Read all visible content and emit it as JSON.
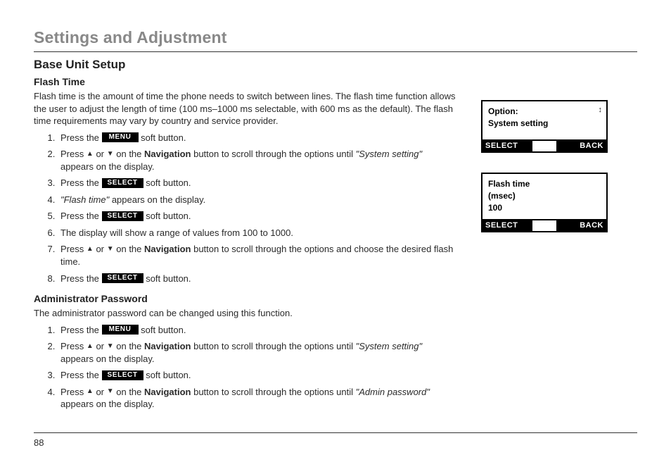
{
  "section_title": "Settings and Adjustment",
  "subhead": "Base Unit Setup",
  "flash_time": {
    "heading": "Flash Time",
    "intro": "Flash time is the amount of time the phone needs to switch between lines. The flash time function allows the user to adjust the length of time (100 ms–1000 ms selectable, with 600 ms as the default). The flash time requirements may vary by country and service provider.",
    "steps": {
      "s1a": "Press the ",
      "s1b": " soft button.",
      "s2a": "Press ",
      "s2b": " or ",
      "s2c": " on the ",
      "s2nav": "Navigation",
      "s2d": " button to scroll through the options until ",
      "s2e": "\"System setting\"",
      "s2f": " appears on the display.",
      "s3a": "Press the ",
      "s3b": " soft button.",
      "s4a": "\"Flash time\"",
      "s4b": " appears on the display.",
      "s5a": "Press the ",
      "s5b": " soft button.",
      "s6": "The display will show a range of values from 100 to 1000.",
      "s7a": "Press ",
      "s7b": " or ",
      "s7c": " on the ",
      "s7nav": "Navigation",
      "s7d": " button to scroll through the options and choose the desired flash time.",
      "s8a": "Press the ",
      "s8b": " soft button."
    }
  },
  "admin_pw": {
    "heading": "Administrator Password",
    "intro": "The administrator password can be changed using this function.",
    "steps": {
      "s1a": "Press the ",
      "s1b": " soft button.",
      "s2a": "Press ",
      "s2b": " or ",
      "s2c": " on the ",
      "s2nav": "Navigation",
      "s2d": " button to scroll through the options until ",
      "s2e": "\"System setting\"",
      "s2f": " appears on the display.",
      "s3a": "Press the ",
      "s3b": " soft button.",
      "s4a": "Press ",
      "s4b": " or ",
      "s4c": " on the ",
      "s4nav": "Navigation",
      "s4d": " button to scroll through the options until ",
      "s4e": "\"Admin password\"",
      "s4f": " appears on the display."
    }
  },
  "softkeys": {
    "menu": "MENU",
    "select": "SELECT"
  },
  "lcd1": {
    "line1": "Option:",
    "line2": "System setting",
    "soft_left": "SELECT",
    "soft_right": "BACK",
    "scroll": "↕"
  },
  "lcd2": {
    "line1": "Flash time",
    "line2": "(msec)",
    "line3": "100",
    "soft_left": "SELECT",
    "soft_right": "BACK"
  },
  "page_number": "88"
}
